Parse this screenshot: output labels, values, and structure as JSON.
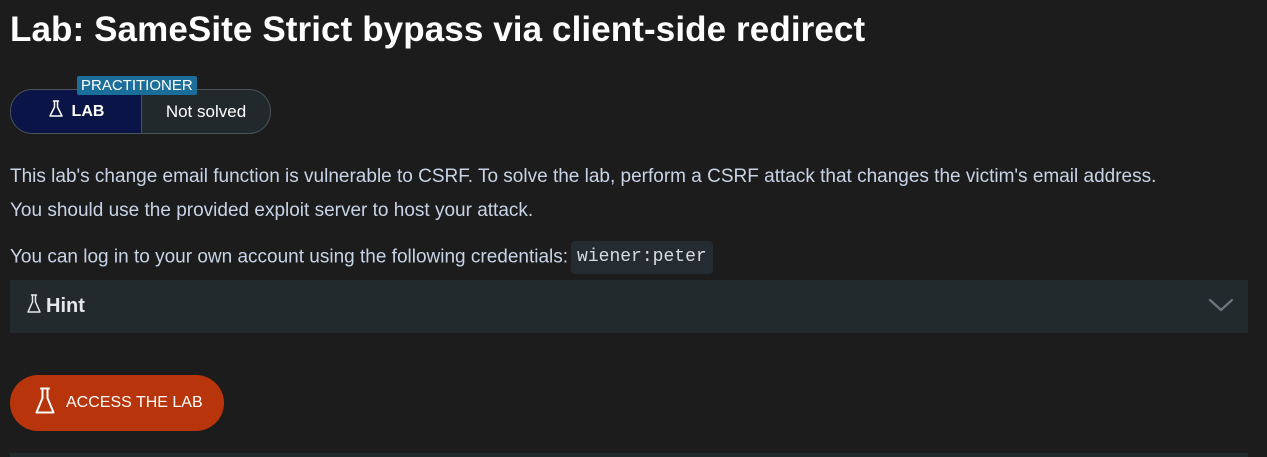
{
  "lab": {
    "title": "Lab: SameSite Strict bypass via client-side redirect",
    "level": "PRACTITIONER",
    "badge_label": "LAB",
    "status": "Not solved"
  },
  "description": {
    "line1": "This lab's change email function is vulnerable to CSRF. To solve the lab, perform a CSRF attack that changes the victim's email address.",
    "line2": "You should use the provided exploit server to host your attack.",
    "credentials_prefix": "You can log in to your own account using the following credentials:",
    "credentials": "wiener:peter"
  },
  "hint": {
    "label": "Hint",
    "icon": "flask-icon",
    "expand_icon": "chevron-down-icon"
  },
  "access": {
    "label": "ACCESS THE LAB",
    "icon": "flask-icon"
  },
  "colors": {
    "background": "#1c1c1c",
    "level_tag": "#1b6e99",
    "lab_pill": "#0a1446",
    "access_button": "#b8350c",
    "hint_bar": "#232a2d",
    "description_text": "#c8d4e6"
  }
}
